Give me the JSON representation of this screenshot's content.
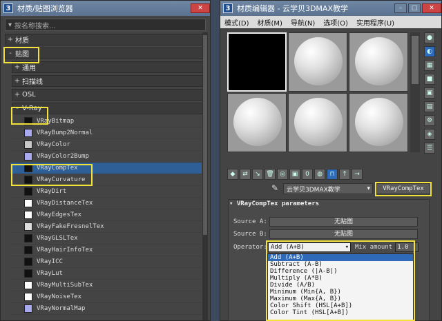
{
  "browser": {
    "app_icon": "3",
    "title": "材质/贴图浏览器",
    "search_placeholder": "按名称搜索...",
    "categories": {
      "materials": "材质",
      "maps": "贴图"
    },
    "maps_sub": {
      "general": "通用",
      "scanline": "扫描线",
      "osl": "OSL",
      "vray": "V-Ray"
    },
    "vray_maps": [
      {
        "name": "VRayBitmap",
        "color": "#111111"
      },
      {
        "name": "VRayBump2Normal",
        "color": "#a9a9f0"
      },
      {
        "name": "VRayColor",
        "color": "#c8c8c8"
      },
      {
        "name": "VRayColor2Bump",
        "color": "#a9a9f0"
      },
      {
        "name": "VRayCompTex",
        "color": "#111111"
      },
      {
        "name": "VRayCurvature",
        "color": "#111111"
      },
      {
        "name": "VRayDirt",
        "color": "#111111"
      },
      {
        "name": "VRayDistanceTex",
        "color": "#ffffff"
      },
      {
        "name": "VRayEdgesTex",
        "color": "#ffffff"
      },
      {
        "name": "VRayFakeFresnelTex",
        "color": "#dddddd"
      },
      {
        "name": "VRayGLSLTex",
        "color": "#111111"
      },
      {
        "name": "VRayHairInfoTex",
        "color": "#111111"
      },
      {
        "name": "VRayICC",
        "color": "#111111"
      },
      {
        "name": "VRayLut",
        "color": "#111111"
      },
      {
        "name": "VRayMultiSubTex",
        "color": "#ffffff"
      },
      {
        "name": "VRayNoiseTex",
        "color": "#ffffff"
      },
      {
        "name": "VRayNormalMap",
        "color": "#a9a9f0"
      }
    ]
  },
  "editor": {
    "app_icon": "3",
    "title": "材质编辑器 - 云学贝3DMAX教学",
    "menu": [
      "模式(D)",
      "材质(M)",
      "导航(N)",
      "选项(O)",
      "实用程序(U)"
    ],
    "material_name": "云学贝3DMAX教学",
    "map_type": "VRayCompTex",
    "rollout_title": "VRayCompTex parameters",
    "source_a_label": "Source A:",
    "source_b_label": "Source B:",
    "no_map": "无贴图",
    "operator_label": "Operator:",
    "operator_value": "Add (A+B)",
    "mix_amount_label": "Mix amount",
    "mix_amount_value": "1.0",
    "operator_options": [
      "Add (A+B)",
      "Subtract (A-B)",
      "Difference (|A-B|)",
      "Multiply (A*B)",
      "Divide (A/B)",
      "Minimum (Min{A, B})",
      "Maximum (Max{A, B})",
      "Color Shift (HSL[A+B])",
      "Color Tint (HSL[A+B])"
    ],
    "highlight_color": "#f3e23a"
  }
}
